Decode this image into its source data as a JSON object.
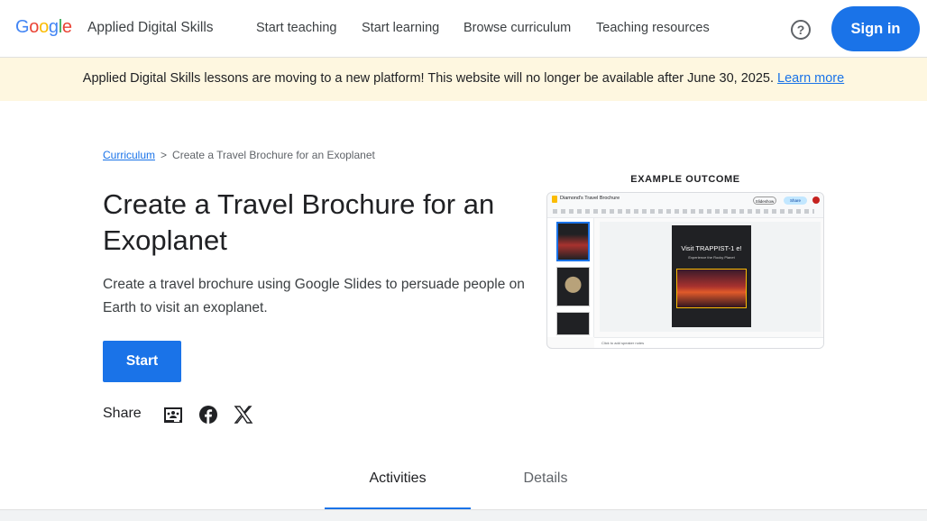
{
  "header": {
    "logo": [
      "G",
      "o",
      "o",
      "g",
      "l",
      "e"
    ],
    "logo_colors": [
      "#4285f4",
      "#ea4335",
      "#fbbc05",
      "#4285f4",
      "#34a853",
      "#ea4335"
    ],
    "product": "Applied Digital Skills",
    "nav": [
      "Start teaching",
      "Start learning",
      "Browse curriculum",
      "Teaching resources"
    ],
    "help_icon": "help-circle-icon",
    "signin": "Sign in"
  },
  "banner": {
    "text": "Applied Digital Skills lessons are moving to a new platform! This website will no longer be available after June 30, 2025.",
    "link": "Learn more"
  },
  "breadcrumb": {
    "root": "Curriculum",
    "separator": ">",
    "current": "Create a Travel Brochure for an Exoplanet"
  },
  "main": {
    "title": "Create a Travel Brochure for an Exoplanet",
    "description": "Create a travel brochure using Google Slides to persuade people on Earth to visit an exoplanet.",
    "start": "Start",
    "share_label": "Share",
    "share_icons": [
      "google-classroom-icon",
      "facebook-icon",
      "x-icon"
    ]
  },
  "example": {
    "label": "EXAMPLE OUTCOME",
    "doc_title": "Diamond's Travel Brochure",
    "slide_title": "Visit TRAPPIST-1 e!",
    "slide_subtitle": "Experience the Rocky Planet",
    "share": "Share",
    "slideshow": "Slideshow",
    "notes": "Click to add speaker notes"
  },
  "tabs": [
    "Activities",
    "Details"
  ],
  "colors": {
    "accent": "#1a73e8",
    "banner": "#fef7e0"
  }
}
